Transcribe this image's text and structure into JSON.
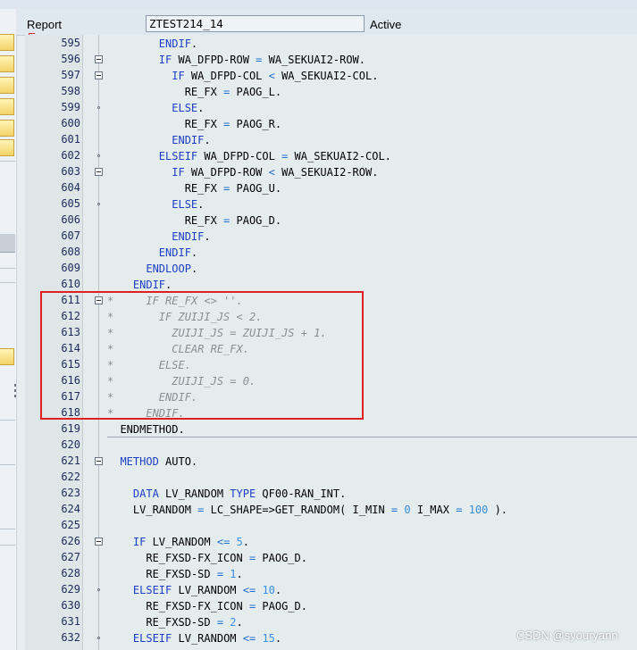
{
  "header": {
    "object_type_label": "Report",
    "program_name": "ZTEST214_14",
    "status": "Active"
  },
  "editor": {
    "lines": [
      {
        "no": "595",
        "marker": "none",
        "tokens": [
          {
            "t": "        "
          },
          {
            "t": "ENDIF",
            "c": "kw"
          },
          {
            "t": "."
          }
        ]
      },
      {
        "no": "596",
        "marker": "fold",
        "tokens": [
          {
            "t": "        "
          },
          {
            "t": "IF",
            "c": "kw"
          },
          {
            "t": " WA_DFPD-ROW "
          },
          {
            "t": "=",
            "c": "op"
          },
          {
            "t": " WA_SEKUAI2-ROW."
          }
        ]
      },
      {
        "no": "597",
        "marker": "fold",
        "tokens": [
          {
            "t": "          "
          },
          {
            "t": "IF",
            "c": "kw"
          },
          {
            "t": " WA_DFPD-COL "
          },
          {
            "t": "<",
            "c": "op"
          },
          {
            "t": " WA_SEKUAI2-COL."
          }
        ]
      },
      {
        "no": "598",
        "marker": "none",
        "tokens": [
          {
            "t": "            RE_FX "
          },
          {
            "t": "=",
            "c": "op"
          },
          {
            "t": " PAOG_L."
          }
        ]
      },
      {
        "no": "599",
        "marker": "dot",
        "tokens": [
          {
            "t": "          "
          },
          {
            "t": "ELSE",
            "c": "kw"
          },
          {
            "t": "."
          }
        ]
      },
      {
        "no": "600",
        "marker": "none",
        "tokens": [
          {
            "t": "            RE_FX "
          },
          {
            "t": "=",
            "c": "op"
          },
          {
            "t": " PAOG_R."
          }
        ]
      },
      {
        "no": "601",
        "marker": "none",
        "tokens": [
          {
            "t": "          "
          },
          {
            "t": "ENDIF",
            "c": "kw"
          },
          {
            "t": "."
          }
        ]
      },
      {
        "no": "602",
        "marker": "dot",
        "tokens": [
          {
            "t": "        "
          },
          {
            "t": "ELSEIF",
            "c": "kw"
          },
          {
            "t": " WA_DFPD-COL "
          },
          {
            "t": "=",
            "c": "op"
          },
          {
            "t": " WA_SEKUAI2-COL."
          }
        ]
      },
      {
        "no": "603",
        "marker": "fold",
        "tokens": [
          {
            "t": "          "
          },
          {
            "t": "IF",
            "c": "kw"
          },
          {
            "t": " WA_DFPD-ROW "
          },
          {
            "t": "<",
            "c": "op"
          },
          {
            "t": " WA_SEKUAI2-ROW."
          }
        ]
      },
      {
        "no": "604",
        "marker": "none",
        "tokens": [
          {
            "t": "            RE_FX "
          },
          {
            "t": "=",
            "c": "op"
          },
          {
            "t": " PAOG_U."
          }
        ]
      },
      {
        "no": "605",
        "marker": "dot",
        "tokens": [
          {
            "t": "          "
          },
          {
            "t": "ELSE",
            "c": "kw"
          },
          {
            "t": "."
          }
        ]
      },
      {
        "no": "606",
        "marker": "none",
        "tokens": [
          {
            "t": "            RE_FX "
          },
          {
            "t": "=",
            "c": "op"
          },
          {
            "t": " PAOG_D."
          }
        ]
      },
      {
        "no": "607",
        "marker": "none",
        "tokens": [
          {
            "t": "          "
          },
          {
            "t": "ENDIF",
            "c": "kw"
          },
          {
            "t": "."
          }
        ]
      },
      {
        "no": "608",
        "marker": "none",
        "tokens": [
          {
            "t": "        "
          },
          {
            "t": "ENDIF",
            "c": "kw"
          },
          {
            "t": "."
          }
        ]
      },
      {
        "no": "609",
        "marker": "none",
        "tokens": [
          {
            "t": "      "
          },
          {
            "t": "ENDLOOP",
            "c": "kw"
          },
          {
            "t": "."
          }
        ]
      },
      {
        "no": "610",
        "marker": "none",
        "tokens": [
          {
            "t": "    "
          },
          {
            "t": "ENDIF",
            "c": "kw"
          },
          {
            "t": "."
          }
        ]
      },
      {
        "no": "611",
        "marker": "fold",
        "tokens": [
          {
            "t": "*     IF RE_FX <> ''.",
            "c": "cm"
          }
        ]
      },
      {
        "no": "612",
        "marker": "none",
        "tokens": [
          {
            "t": "*       IF ZUIJI_JS < 2.",
            "c": "cm"
          }
        ]
      },
      {
        "no": "613",
        "marker": "none",
        "tokens": [
          {
            "t": "*         ZUIJI_JS = ZUIJI_JS + 1.",
            "c": "cm"
          }
        ]
      },
      {
        "no": "614",
        "marker": "none",
        "tokens": [
          {
            "t": "*         CLEAR RE_FX.",
            "c": "cm"
          }
        ]
      },
      {
        "no": "615",
        "marker": "none",
        "tokens": [
          {
            "t": "*       ELSE.",
            "c": "cm"
          }
        ]
      },
      {
        "no": "616",
        "marker": "none",
        "tokens": [
          {
            "t": "*         ZUIJI_JS = 0.",
            "c": "cm"
          }
        ]
      },
      {
        "no": "617",
        "marker": "none",
        "tokens": [
          {
            "t": "*       ENDIF.",
            "c": "cm"
          }
        ]
      },
      {
        "no": "618",
        "marker": "none",
        "tokens": [
          {
            "t": "*     ENDIF.",
            "c": "cm"
          }
        ]
      },
      {
        "no": "619",
        "marker": "none",
        "tokens": [
          {
            "t": "  ENDMETHOD."
          }
        ]
      },
      {
        "no": "620",
        "marker": "none",
        "tokens": []
      },
      {
        "no": "621",
        "marker": "fold",
        "tokens": [
          {
            "t": "  "
          },
          {
            "t": "METHOD",
            "c": "kw"
          },
          {
            "t": " AUTO."
          }
        ]
      },
      {
        "no": "622",
        "marker": "none",
        "tokens": []
      },
      {
        "no": "623",
        "marker": "none",
        "tokens": [
          {
            "t": "    "
          },
          {
            "t": "DATA",
            "c": "kw"
          },
          {
            "t": " LV_RANDOM "
          },
          {
            "t": "TYPE",
            "c": "kw"
          },
          {
            "t": " QF00-RAN_INT."
          }
        ]
      },
      {
        "no": "624",
        "marker": "none",
        "tokens": [
          {
            "t": "    LV_RANDOM "
          },
          {
            "t": "=",
            "c": "op"
          },
          {
            "t": " LC_SHAPE=>GET_RANDOM( I_MIN "
          },
          {
            "t": "=",
            "c": "op"
          },
          {
            "t": " "
          },
          {
            "t": "0",
            "c": "num"
          },
          {
            "t": " I_MAX "
          },
          {
            "t": "=",
            "c": "op"
          },
          {
            "t": " "
          },
          {
            "t": "100",
            "c": "num"
          },
          {
            "t": " )."
          }
        ]
      },
      {
        "no": "625",
        "marker": "none",
        "tokens": []
      },
      {
        "no": "626",
        "marker": "fold",
        "tokens": [
          {
            "t": "    "
          },
          {
            "t": "IF",
            "c": "kw"
          },
          {
            "t": " LV_RANDOM "
          },
          {
            "t": "<=",
            "c": "op"
          },
          {
            "t": " "
          },
          {
            "t": "5",
            "c": "num"
          },
          {
            "t": "."
          }
        ]
      },
      {
        "no": "627",
        "marker": "none",
        "tokens": [
          {
            "t": "      RE_FXSD-FX_ICON "
          },
          {
            "t": "=",
            "c": "op"
          },
          {
            "t": " PAOG_D."
          }
        ]
      },
      {
        "no": "628",
        "marker": "none",
        "tokens": [
          {
            "t": "      RE_FXSD-SD "
          },
          {
            "t": "=",
            "c": "op"
          },
          {
            "t": " "
          },
          {
            "t": "1",
            "c": "num"
          },
          {
            "t": "."
          }
        ]
      },
      {
        "no": "629",
        "marker": "dot",
        "tokens": [
          {
            "t": "    "
          },
          {
            "t": "ELSEIF",
            "c": "kw"
          },
          {
            "t": " LV_RANDOM "
          },
          {
            "t": "<=",
            "c": "op"
          },
          {
            "t": " "
          },
          {
            "t": "10",
            "c": "num"
          },
          {
            "t": "."
          }
        ]
      },
      {
        "no": "630",
        "marker": "none",
        "tokens": [
          {
            "t": "      RE_FXSD-FX_ICON "
          },
          {
            "t": "=",
            "c": "op"
          },
          {
            "t": " PAOG_D."
          }
        ]
      },
      {
        "no": "631",
        "marker": "none",
        "tokens": [
          {
            "t": "      RE_FXSD-SD "
          },
          {
            "t": "=",
            "c": "op"
          },
          {
            "t": " "
          },
          {
            "t": "2",
            "c": "num"
          },
          {
            "t": "."
          }
        ]
      },
      {
        "no": "632",
        "marker": "dot",
        "tokens": [
          {
            "t": "    "
          },
          {
            "t": "ELSEIF",
            "c": "kw"
          },
          {
            "t": " LV_RANDOM "
          },
          {
            "t": "<=",
            "c": "op"
          },
          {
            "t": " "
          },
          {
            "t": "15",
            "c": "num"
          },
          {
            "t": "."
          }
        ]
      }
    ]
  },
  "watermark": "CSDN @syouryann",
  "colors": {
    "keyword": "#1c3fc4",
    "operator": "#1f6fd0",
    "number": "#3a8fe0",
    "comment": "#8a8f95",
    "highlight_box": "#e02020"
  }
}
